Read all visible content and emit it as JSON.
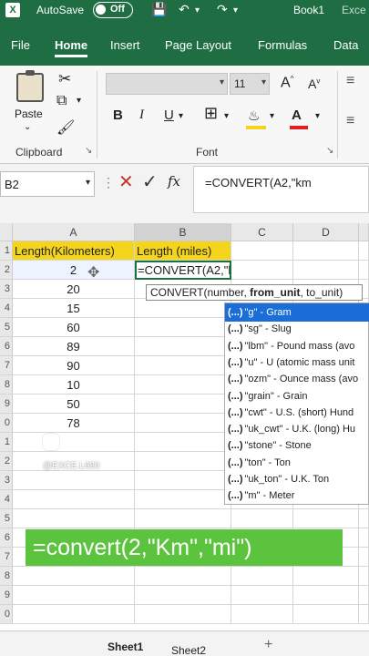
{
  "titlebar": {
    "autosave_label": "AutoSave",
    "autosave_state": "Off",
    "book_name": "Book1",
    "app_name": "Exce",
    "icons": [
      "excel-icon",
      "save-icon",
      "undo-icon",
      "redo-icon"
    ]
  },
  "tabs": [
    {
      "label": "File",
      "active": false
    },
    {
      "label": "Home",
      "active": true
    },
    {
      "label": "Insert",
      "active": false
    },
    {
      "label": "Page Layout",
      "active": false
    },
    {
      "label": "Formulas",
      "active": false
    },
    {
      "label": "Data",
      "active": false
    }
  ],
  "ribbon": {
    "clipboard": {
      "paste_label": "Paste",
      "group_label": "Clipboard"
    },
    "font": {
      "font_name": "",
      "font_size": "11",
      "bold": "B",
      "italic": "I",
      "underline": "U",
      "group_label": "Font"
    }
  },
  "formula_bar": {
    "name_box": "B2",
    "fx": "fx",
    "formula": "=CONVERT(A2,\"km"
  },
  "grid": {
    "columns": [
      "A",
      "B",
      "C",
      "D"
    ],
    "selected_column": "B",
    "row_numbers": [
      "1",
      "2",
      "3",
      "4",
      "5",
      "6",
      "7",
      "8",
      "9",
      "0",
      "1",
      "2",
      "3",
      "4",
      "5",
      "6",
      "7",
      "8",
      "9",
      "0"
    ],
    "header_row": {
      "A": "Length(Kilometers)",
      "B": "Length (miles)"
    },
    "a_values": [
      "2",
      "20",
      "15",
      "60",
      "89",
      "90",
      "10",
      "50",
      "78"
    ],
    "b2_editing": "=CONVERT(A2,\"km"
  },
  "tooltip": {
    "func": "CONVERT(number, ",
    "bold_arg": "from_unit",
    "rest": ", to_unit)"
  },
  "autocomplete": {
    "icon": "(...)",
    "items": [
      "\"g\" - Gram",
      "\"sg\" - Slug",
      "\"lbm\" - Pound mass (avo",
      "\"u\" - U (atomic mass unit",
      "\"ozm\" - Ounce mass (avo",
      "\"grain\" - Grain",
      "\"cwt\" - U.S. (short) Hund",
      "\"uk_cwt\" - U.K. (long) Hu",
      "\"stone\" - Stone",
      "\"ton\" - Ton",
      "\"uk_ton\" - U.K. Ton",
      "\"m\" - Meter"
    ],
    "highlighted_index": 0
  },
  "overlay": {
    "handle": "@EXCE.L680",
    "caption": "=convert(2,\"Km\",\"mi\")"
  },
  "sheets": {
    "tabs": [
      "Sheet1",
      "Sheet2"
    ],
    "active": "Sheet1"
  },
  "colors": {
    "excel_green": "#1f6e43",
    "header_fill": "#f5d51b",
    "caption_green": "#5cc33f",
    "highlight_blue": "#1b6ed8"
  }
}
